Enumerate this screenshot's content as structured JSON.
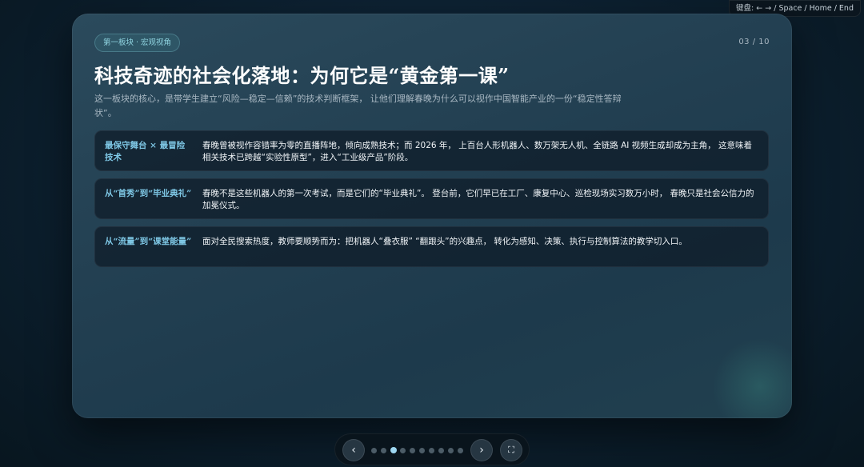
{
  "hint": "键盘: ← → / Space / Home / End",
  "slide": {
    "section": "第一板块 · 宏观视角",
    "page": "03 / 10",
    "title": "科技奇迹的社会化落地：为何它是“黄金第一课”",
    "subtitle": "这一板块的核心，是带学生建立“风险—稳定—信赖”的技术判断框架， 让他们理解春晚为什么可以视作中国智能产业的一份“稳定性答辩状”。",
    "cards": [
      {
        "label": "最保守舞台 × 最冒险技术",
        "text": "春晚曾被视作容错率为零的直播阵地，倾向成熟技术；而 2026 年， 上百台人形机器人、数万架无人机、全链路 AI 视频生成却成为主角， 这意味着相关技术已跨越“实验性原型”，进入“工业级产品”阶段。"
      },
      {
        "label": "从“首秀”到“毕业典礼”",
        "text": "春晚不是这些机器人的第一次考试，而是它们的“毕业典礼”。 登台前，它们早已在工厂、康复中心、巡检现场实习数万小时， 春晚只是社会公信力的加冕仪式。"
      },
      {
        "label": "从“流量”到“课堂能量”",
        "text": "面对全民搜索热度，教师要顺势而为：把机器人“叠衣服” “翻跟头”的兴趣点， 转化为感知、决策、执行与控制算法的教学切入口。"
      }
    ]
  },
  "nav": {
    "prev_icon": "‹",
    "next_icon": "›",
    "fullscreen_icon": "⛶",
    "total_slides": 10,
    "current_index": 3
  },
  "colors": {
    "accent": "#7fc8e6",
    "active_dot": "#9ed8f2",
    "card_bg": "#101e2a"
  }
}
